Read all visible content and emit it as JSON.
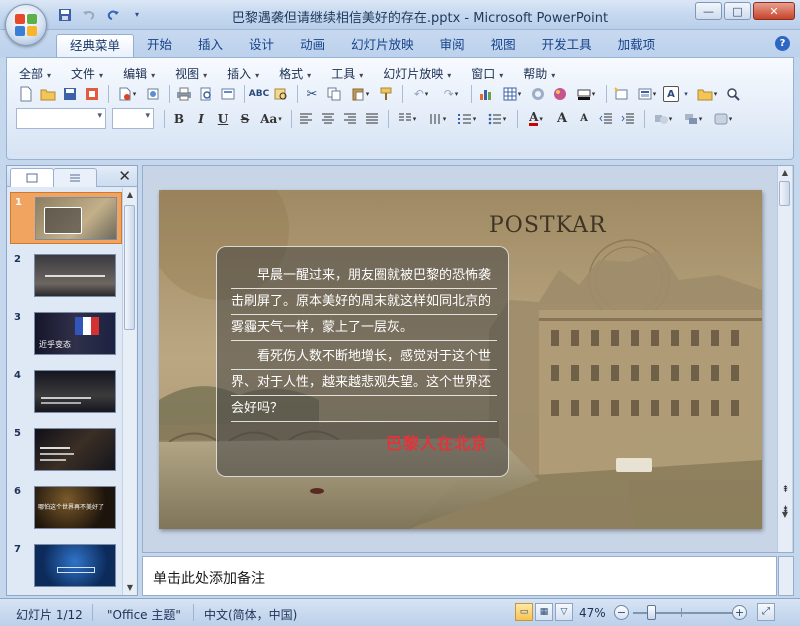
{
  "window": {
    "title": "巴黎遇袭但请继续相信美好的存在.pptx - Microsoft PowerPoint",
    "minimize": "—",
    "maximize": "□",
    "close": "✕"
  },
  "quick_access": {
    "save_icon": "save-icon",
    "undo_icon": "undo-icon",
    "redo_icon": "redo-icon"
  },
  "ribbon_tabs": [
    "经典菜单",
    "开始",
    "插入",
    "设计",
    "动画",
    "幻灯片放映",
    "审阅",
    "视图",
    "开发工具",
    "加载项"
  ],
  "classic_menu": [
    "全部",
    "文件",
    "编辑",
    "视图",
    "插入",
    "格式",
    "工具",
    "幻灯片放映",
    "窗口",
    "帮助"
  ],
  "toolbar": {
    "bold": "B",
    "italic": "I",
    "underline": "U",
    "strike": "S",
    "change_case": "Aa",
    "grow_font": "A",
    "shrink_font": "A"
  },
  "slide_pane": {
    "close": "✕",
    "thumbnails": [
      {
        "num": "1",
        "selected": true,
        "caption": ""
      },
      {
        "num": "2",
        "selected": false,
        "caption": ""
      },
      {
        "num": "3",
        "selected": false,
        "caption": "近乎变态"
      },
      {
        "num": "4",
        "selected": false,
        "caption": ""
      },
      {
        "num": "5",
        "selected": false,
        "caption": ""
      },
      {
        "num": "6",
        "selected": false,
        "caption": "哪怕这个世界再不美好了"
      },
      {
        "num": "7",
        "selected": false,
        "caption": ""
      }
    ]
  },
  "slide": {
    "postcard_text": "POSTKAR",
    "para1": [
      "早晨一醒过来，朋友圈就被巴黎的恐怖袭",
      "击刷屏了。原本美好的周末就这样如同北京的",
      "雾霾天气一样，蒙上了一层灰。"
    ],
    "para2": [
      "看死伤人数不断地增长，感觉对于这个世",
      "界、对于人性，越来越悲观失望。这个世界还",
      "会好吗？"
    ],
    "subtitle": "巴黎人在北京",
    "subtitle_color": "#e2333b"
  },
  "notes": {
    "placeholder": "单击此处添加备注"
  },
  "status": {
    "slide_info": "幻灯片 1/12",
    "theme": "\"Office 主题\"",
    "language": "中文(简体，中国)",
    "zoom": "47%",
    "zoom_minus": "−",
    "zoom_plus": "+"
  }
}
